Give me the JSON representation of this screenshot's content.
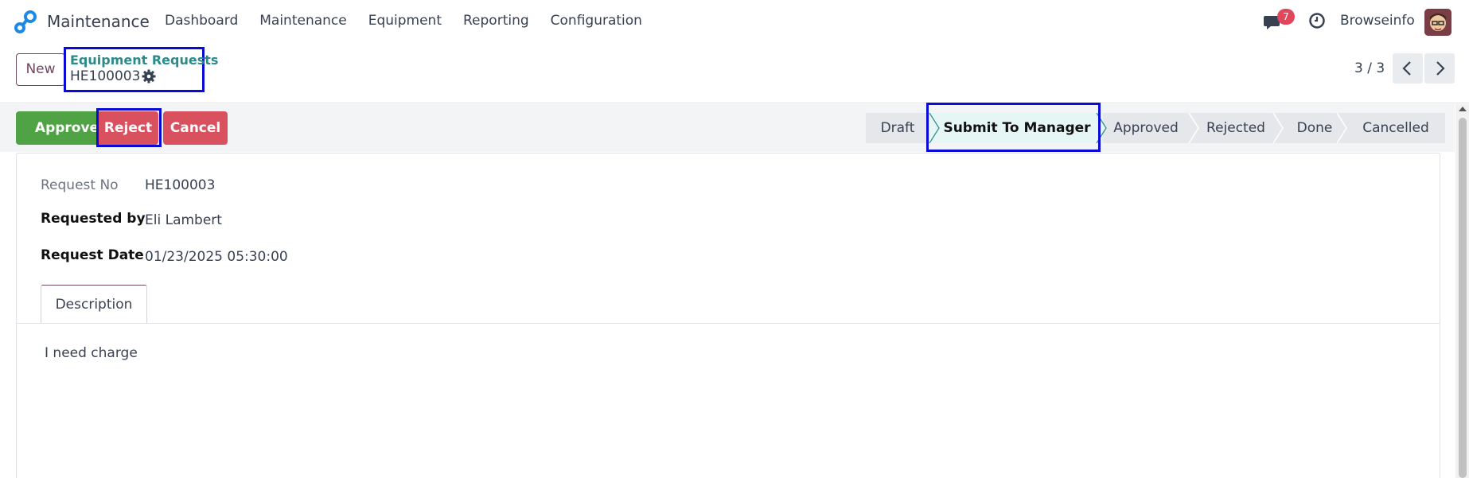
{
  "nav": {
    "app_title": "Maintenance",
    "menu": [
      "Dashboard",
      "Maintenance",
      "Equipment",
      "Reporting",
      "Configuration"
    ],
    "chat_count": "7",
    "user_name": "Browseinfo"
  },
  "control": {
    "new_label": "New",
    "breadcrumb_parent": "Equipment Requests",
    "breadcrumb_current": "HE100003",
    "pager": "3 / 3"
  },
  "actions": {
    "approve": "Approve",
    "reject": "Reject",
    "cancel": "Cancel"
  },
  "stages": [
    "Draft",
    "Submit To Manager",
    "Approved",
    "Rejected",
    "Done",
    "Cancelled"
  ],
  "active_stage": "Submit To Manager",
  "form": {
    "request_no_label": "Request No",
    "request_no": "HE100003",
    "requested_by_label": "Requested by",
    "requested_by": "Eli Lambert",
    "request_date_label": "Request Date",
    "request_date": "01/23/2025 05:30:00"
  },
  "tabs": {
    "description": "Description"
  },
  "description_text": "I need charge",
  "colors": {
    "approve": "#4fa345",
    "reject": "#d9515f",
    "highlight_box": "#0a0ad6",
    "active_stage_bg": "#e6f6f5",
    "brand": "#71475e"
  }
}
